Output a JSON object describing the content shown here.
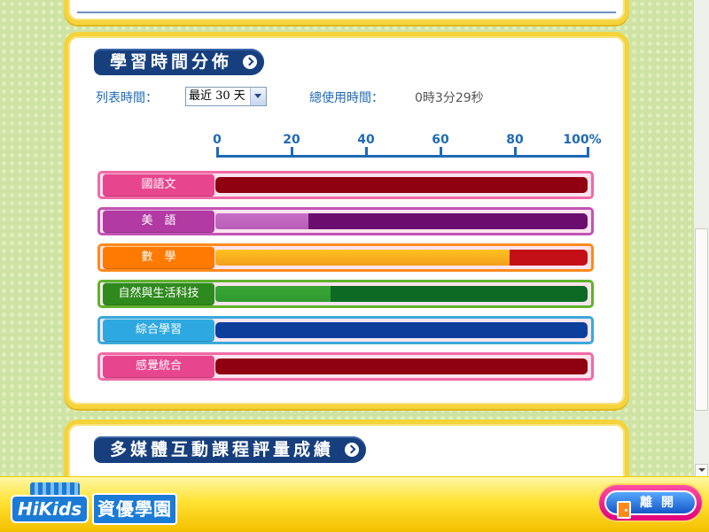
{
  "section1": {
    "title": "學習時間分佈"
  },
  "filter": {
    "period_label": "列表時間：",
    "period_selected": "最近 30 天",
    "total_label": "總使用時間：",
    "total_value": "0時3分29秒"
  },
  "chart_data": {
    "type": "bar",
    "orientation": "horizontal",
    "scale_labels": [
      "0",
      "20",
      "40",
      "60",
      "80",
      "100%"
    ],
    "xlim": [
      0,
      100
    ],
    "categories": [
      "國語文",
      "美　語",
      "數　學",
      "自然與生活科技",
      "綜合學習",
      "感覺統合"
    ],
    "values": [
      0,
      25,
      79,
      31,
      0,
      0
    ],
    "colors": {
      "國語文": {
        "border": "#f06aa6",
        "label": "#e8458f",
        "track": "#8f0010",
        "fill": "#b00020"
      },
      "美　語": {
        "border": "#c254b5",
        "label": "#b23aa3",
        "track": "#6a0d6e",
        "fill": "#c870c8"
      },
      "數　學": {
        "border": "#ff8a1c",
        "label": "#ff7a00",
        "track": "#c40f16",
        "fill": "#ffc21f"
      },
      "自然與生活科技": {
        "border": "#5fb22c",
        "label": "#2f8a1e",
        "track": "#0d6a24",
        "fill": "#3aa635"
      },
      "綜合學習": {
        "border": "#3aa9dc",
        "label": "#2ea8e0",
        "track": "#0c3f9c",
        "fill": "#1f5ac8"
      },
      "感覺統合": {
        "border": "#f06aa6",
        "label": "#e8458f",
        "track": "#8f0010",
        "fill": "#b00020"
      }
    }
  },
  "section2": {
    "title": "多媒體互動課程評量成績"
  },
  "footer": {
    "logo_hikids": "HiKids",
    "logo_name": "資優學園",
    "exit_label": "離開"
  }
}
